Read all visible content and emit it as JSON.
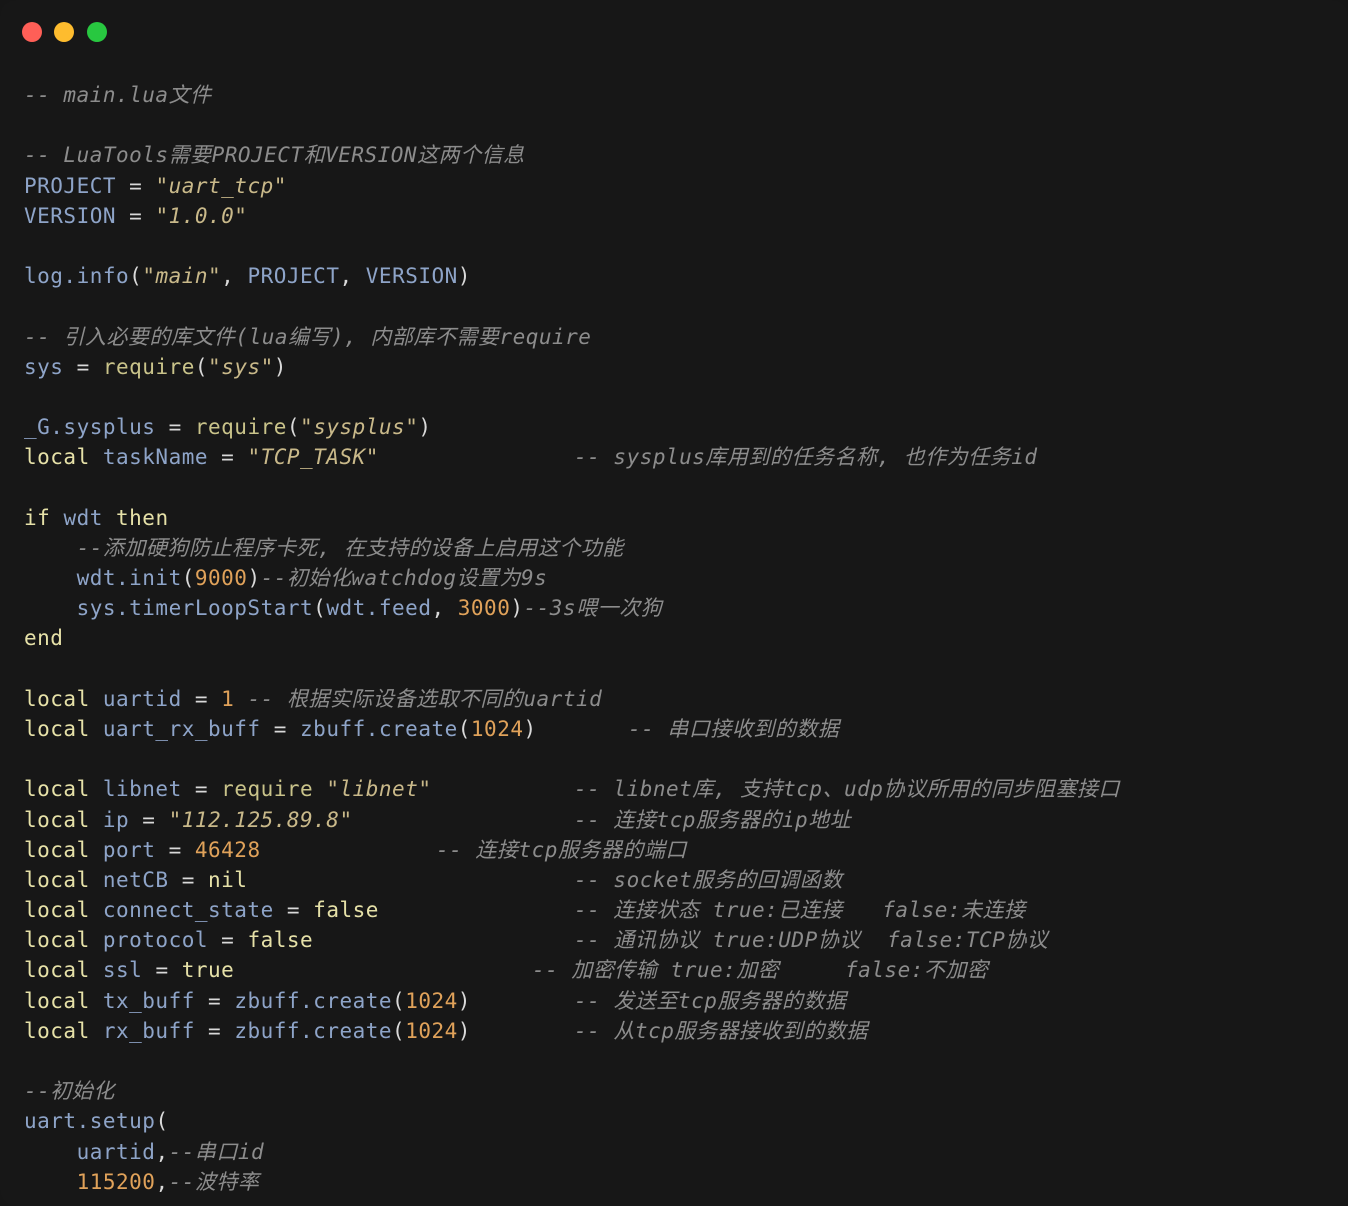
{
  "window": {
    "controls": [
      "close",
      "minimize",
      "maximize"
    ]
  },
  "code": {
    "lines": [
      {
        "tokens": [
          {
            "t": "-- main.lua文件",
            "c": "com"
          }
        ]
      },
      {
        "tokens": []
      },
      {
        "tokens": [
          {
            "t": "-- LuaTools需要PROJECT和VERSION这两个信息",
            "c": "com"
          }
        ]
      },
      {
        "tokens": [
          {
            "t": "PROJECT",
            "c": "var"
          },
          {
            "t": " = ",
            "c": "punc"
          },
          {
            "t": "\"uart_tcp\"",
            "c": "str"
          }
        ]
      },
      {
        "tokens": [
          {
            "t": "VERSION",
            "c": "var"
          },
          {
            "t": " = ",
            "c": "punc"
          },
          {
            "t": "\"1.0.0\"",
            "c": "str"
          }
        ]
      },
      {
        "tokens": []
      },
      {
        "tokens": [
          {
            "t": "log.info",
            "c": "var"
          },
          {
            "t": "(",
            "c": "punc"
          },
          {
            "t": "\"main\"",
            "c": "str"
          },
          {
            "t": ", ",
            "c": "punc"
          },
          {
            "t": "PROJECT",
            "c": "var"
          },
          {
            "t": ", ",
            "c": "punc"
          },
          {
            "t": "VERSION",
            "c": "var"
          },
          {
            "t": ")",
            "c": "punc"
          }
        ]
      },
      {
        "tokens": []
      },
      {
        "tokens": [
          {
            "t": "-- 引入必要的库文件(lua编写), 内部库不需要require",
            "c": "com"
          }
        ]
      },
      {
        "tokens": [
          {
            "t": "sys",
            "c": "var"
          },
          {
            "t": " = ",
            "c": "punc"
          },
          {
            "t": "require",
            "c": "fn"
          },
          {
            "t": "(",
            "c": "punc"
          },
          {
            "t": "\"sys\"",
            "c": "str"
          },
          {
            "t": ")",
            "c": "punc"
          }
        ]
      },
      {
        "tokens": []
      },
      {
        "tokens": [
          {
            "t": "_G.sysplus",
            "c": "var"
          },
          {
            "t": " = ",
            "c": "punc"
          },
          {
            "t": "require",
            "c": "fn"
          },
          {
            "t": "(",
            "c": "punc"
          },
          {
            "t": "\"sysplus\"",
            "c": "str"
          },
          {
            "t": ")",
            "c": "punc"
          }
        ]
      },
      {
        "tokens": [
          {
            "t": "local",
            "c": "kw"
          },
          {
            "t": " taskName",
            "c": "var"
          },
          {
            "t": " = ",
            "c": "punc"
          },
          {
            "t": "\"TCP_TASK\"",
            "c": "str"
          }
        ],
        "comment": "-- sysplus库用到的任务名称, 也作为任务id",
        "cc": "c590"
      },
      {
        "tokens": []
      },
      {
        "tokens": [
          {
            "t": "if",
            "c": "kw"
          },
          {
            "t": " wdt",
            "c": "var"
          },
          {
            "t": " then",
            "c": "kw"
          }
        ]
      },
      {
        "tokens": [
          {
            "t": "    --添加硬狗防止程序卡死, 在支持的设备上启用这个功能",
            "c": "com"
          }
        ]
      },
      {
        "tokens": [
          {
            "t": "    wdt.init",
            "c": "var"
          },
          {
            "t": "(",
            "c": "punc"
          },
          {
            "t": "9000",
            "c": "num"
          },
          {
            "t": ")",
            "c": "punc"
          },
          {
            "t": "--初始化watchdog设置为9s",
            "c": "com"
          }
        ]
      },
      {
        "tokens": [
          {
            "t": "    sys.timerLoopStart",
            "c": "var"
          },
          {
            "t": "(",
            "c": "punc"
          },
          {
            "t": "wdt.feed",
            "c": "var"
          },
          {
            "t": ", ",
            "c": "punc"
          },
          {
            "t": "3000",
            "c": "num"
          },
          {
            "t": ")",
            "c": "punc"
          },
          {
            "t": "--3s喂一次狗",
            "c": "com"
          }
        ]
      },
      {
        "tokens": [
          {
            "t": "end",
            "c": "kw"
          }
        ]
      },
      {
        "tokens": []
      },
      {
        "tokens": [
          {
            "t": "local",
            "c": "kw"
          },
          {
            "t": " uartid",
            "c": "var"
          },
          {
            "t": " = ",
            "c": "punc"
          },
          {
            "t": "1",
            "c": "num"
          },
          {
            "t": " -- 根据实际设备选取不同的uartid",
            "c": "com"
          }
        ]
      },
      {
        "tokens": [
          {
            "t": "local",
            "c": "kw"
          },
          {
            "t": " uart_rx_buff",
            "c": "var"
          },
          {
            "t": " = ",
            "c": "punc"
          },
          {
            "t": "zbuff.create",
            "c": "var"
          },
          {
            "t": "(",
            "c": "punc"
          },
          {
            "t": "1024",
            "c": "num"
          },
          {
            "t": ")",
            "c": "punc"
          }
        ],
        "comment": "-- 串口接收到的数据",
        "cc": "c645"
      },
      {
        "tokens": []
      },
      {
        "tokens": [
          {
            "t": "local",
            "c": "kw"
          },
          {
            "t": " libnet",
            "c": "var"
          },
          {
            "t": " = ",
            "c": "punc"
          },
          {
            "t": "require",
            "c": "fn"
          },
          {
            "t": " \"libnet\"",
            "c": "str"
          }
        ],
        "comment": "-- libnet库, 支持tcp、udp协议所用的同步阻塞接口",
        "cc": "c590"
      },
      {
        "tokens": [
          {
            "t": "local",
            "c": "kw"
          },
          {
            "t": " ip",
            "c": "var"
          },
          {
            "t": " = ",
            "c": "punc"
          },
          {
            "t": "\"112.125.89.8\"",
            "c": "str"
          }
        ],
        "comment": "-- 连接tcp服务器的ip地址",
        "cc": "c590"
      },
      {
        "tokens": [
          {
            "t": "local",
            "c": "kw"
          },
          {
            "t": " port",
            "c": "var"
          },
          {
            "t": " = ",
            "c": "punc"
          },
          {
            "t": "46428",
            "c": "num"
          }
        ],
        "comment": "-- 连接tcp服务器的端口",
        "cc": "c453"
      },
      {
        "tokens": [
          {
            "t": "local",
            "c": "kw"
          },
          {
            "t": " netCB",
            "c": "var"
          },
          {
            "t": " = ",
            "c": "punc"
          },
          {
            "t": "nil",
            "c": "kw"
          }
        ],
        "comment": "-- socket服务的回调函数",
        "cc": "c590"
      },
      {
        "tokens": [
          {
            "t": "local",
            "c": "kw"
          },
          {
            "t": " connect_state",
            "c": "var"
          },
          {
            "t": " = ",
            "c": "punc"
          },
          {
            "t": "false",
            "c": "kw"
          }
        ],
        "comment": "-- 连接状态 true:已连接   false:未连接",
        "cc": "c590"
      },
      {
        "tokens": [
          {
            "t": "local",
            "c": "kw"
          },
          {
            "t": " protocol",
            "c": "var"
          },
          {
            "t": " = ",
            "c": "punc"
          },
          {
            "t": "false",
            "c": "kw"
          }
        ],
        "comment": "-- 通讯协议 true:UDP协议  false:TCP协议",
        "cc": "c590"
      },
      {
        "tokens": [
          {
            "t": "local",
            "c": "kw"
          },
          {
            "t": " ssl",
            "c": "var"
          },
          {
            "t": " = ",
            "c": "punc"
          },
          {
            "t": "true",
            "c": "kw"
          }
        ],
        "comment": "-- 加密传输 true:加密     false:不加密",
        "cc": "c548"
      },
      {
        "tokens": [
          {
            "t": "local",
            "c": "kw"
          },
          {
            "t": " tx_buff",
            "c": "var"
          },
          {
            "t": " = ",
            "c": "punc"
          },
          {
            "t": "zbuff.create",
            "c": "var"
          },
          {
            "t": "(",
            "c": "punc"
          },
          {
            "t": "1024",
            "c": "num"
          },
          {
            "t": ")",
            "c": "punc"
          }
        ],
        "comment": "-- 发送至tcp服务器的数据",
        "cc": "c590"
      },
      {
        "tokens": [
          {
            "t": "local",
            "c": "kw"
          },
          {
            "t": " rx_buff",
            "c": "var"
          },
          {
            "t": " = ",
            "c": "punc"
          },
          {
            "t": "zbuff.create",
            "c": "var"
          },
          {
            "t": "(",
            "c": "punc"
          },
          {
            "t": "1024",
            "c": "num"
          },
          {
            "t": ")",
            "c": "punc"
          }
        ],
        "comment": "-- 从tcp服务器接收到的数据",
        "cc": "c590"
      },
      {
        "tokens": []
      },
      {
        "tokens": [
          {
            "t": "--初始化",
            "c": "com"
          }
        ]
      },
      {
        "tokens": [
          {
            "t": "uart.setup",
            "c": "var"
          },
          {
            "t": "(",
            "c": "punc"
          }
        ]
      },
      {
        "tokens": [
          {
            "t": "    uartid",
            "c": "var"
          },
          {
            "t": ",",
            "c": "punc"
          },
          {
            "t": "--串口id",
            "c": "com"
          }
        ]
      },
      {
        "tokens": [
          {
            "t": "    115200",
            "c": "num"
          },
          {
            "t": ",",
            "c": "punc"
          },
          {
            "t": "--波特率",
            "c": "com"
          }
        ]
      }
    ]
  }
}
